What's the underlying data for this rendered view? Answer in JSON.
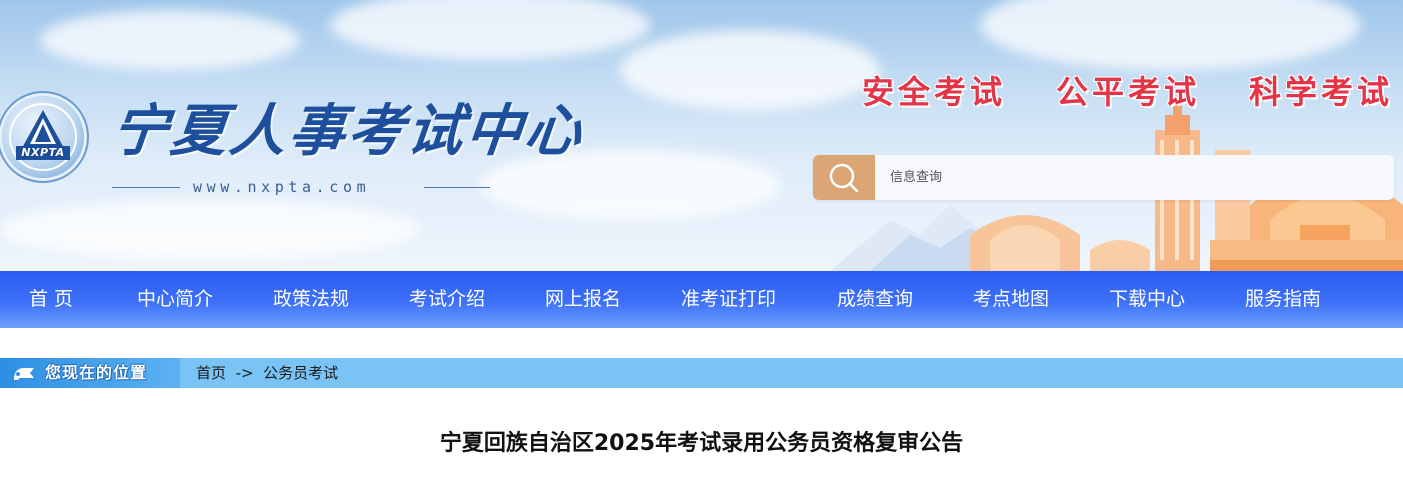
{
  "header": {
    "logo_abbr": "NXPTA",
    "site_title": "宁夏人事考试中心",
    "site_url": "www.nxpta.com",
    "slogans": [
      "安全考试",
      "公平考试",
      "科学考试"
    ],
    "search": {
      "placeholder": "信息查询",
      "value": ""
    }
  },
  "nav": {
    "items": [
      {
        "label": "首 页"
      },
      {
        "label": "中心简介"
      },
      {
        "label": "政策法规"
      },
      {
        "label": "考试介绍"
      },
      {
        "label": "网上报名"
      },
      {
        "label": "准考证打印"
      },
      {
        "label": "成绩查询"
      },
      {
        "label": "考点地图"
      },
      {
        "label": "下载中心"
      },
      {
        "label": "服务指南"
      }
    ]
  },
  "breadcrumb": {
    "label": "您现在的位置",
    "home": "首页",
    "separator": "->",
    "current": "公务员考试"
  },
  "article": {
    "title": "宁夏回族自治区2025年考试录用公务员资格复审公告"
  },
  "colors": {
    "nav_bg": "#3d70f7",
    "slogan": "#e43447",
    "breadcrumb_bar": "#79c4f5",
    "search_button": "#dba575",
    "title_blue": "#1d4f9c"
  },
  "icons": {
    "logo": "nxpta-emblem-icon",
    "search": "search-icon",
    "breadcrumb": "location-flag-icon"
  }
}
